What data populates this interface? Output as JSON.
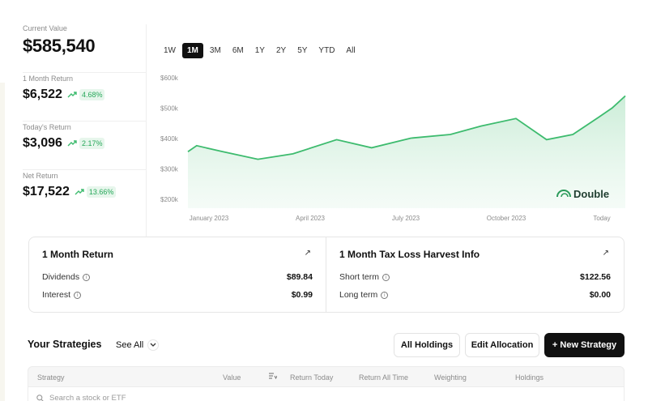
{
  "summary": {
    "current_value_label": "Current Value",
    "current_value": "$585,540",
    "month_return_label": "1 Month Return",
    "month_return_value": "$6,522",
    "month_return_pct": "4.68%",
    "today_return_label": "Today's Return",
    "today_return_value": "$3,096",
    "today_return_pct": "2.17%",
    "net_return_label": "Net Return",
    "net_return_value": "$17,522",
    "net_return_pct": "13.66%"
  },
  "range_tabs": [
    "1W",
    "1M",
    "3M",
    "6M",
    "1Y",
    "2Y",
    "5Y",
    "YTD",
    "All"
  ],
  "selected_range": "1M",
  "colors": {
    "accent_green": "#3dbb6e",
    "area_fill": "#dff3e6",
    "badge_bg": "#e7f6ec"
  },
  "brand": {
    "name": "Double"
  },
  "chart_data": {
    "type": "area",
    "ylabels": [
      "$600k",
      "$500k",
      "$400k",
      "$300k",
      "$200k"
    ],
    "xlabels": [
      "January 2023",
      "April 2023",
      "July 2023",
      "October 2023",
      "Today"
    ],
    "ylim": [
      200000,
      600000
    ],
    "x": [
      0,
      0.02,
      0.08,
      0.16,
      0.24,
      0.34,
      0.42,
      0.51,
      0.6,
      0.67,
      0.75,
      0.82,
      0.88,
      0.94,
      0.97,
      1.0
    ],
    "values": [
      355000,
      375000,
      355000,
      330000,
      348000,
      395000,
      368000,
      400000,
      412000,
      440000,
      465000,
      395000,
      412000,
      470000,
      500000,
      540000
    ],
    "grid": false
  },
  "tax_card": {
    "left_title": "1 Month Return",
    "dividends_label": "Dividends",
    "dividends_value": "$89.84",
    "interest_label": "Interest",
    "interest_value": "$0.99",
    "right_title": "1 Month Tax Loss Harvest Info",
    "short_term_label": "Short term",
    "short_term_value": "$122.56",
    "long_term_label": "Long term",
    "long_term_value": "$0.00"
  },
  "strategies": {
    "title": "Your Strategies",
    "see_all": "See All",
    "all_holdings": "All Holdings",
    "edit_allocation": "Edit Allocation",
    "new_strategy": "+ New Strategy",
    "columns": [
      "Strategy",
      "Value",
      "Return Today",
      "Return All Time",
      "Weighting",
      "Holdings"
    ],
    "search_placeholder": "Search a stock or ETF"
  }
}
